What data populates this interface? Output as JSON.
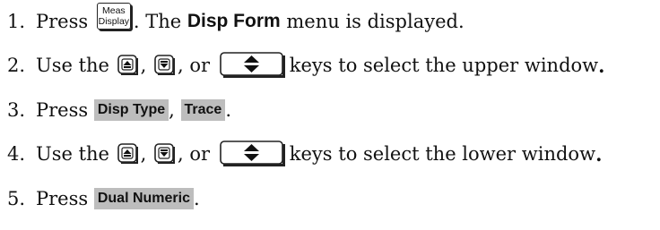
{
  "steps": [
    {
      "number": "1.",
      "text_before": "Press",
      "key_line1": "Meas",
      "key_line2": "Display",
      "text_mid": ". The",
      "menu_name": "Disp Form",
      "text_after": "menu is displayed."
    },
    {
      "number": "2.",
      "text_before": "Use the",
      "sep1": ",",
      "sep2": ", or",
      "text_after": "keys to select the upper window",
      "period": "."
    },
    {
      "number": "3.",
      "text_before": "Press",
      "softkey1": "Disp Type",
      "sep": ",",
      "softkey2": "Trace",
      "end": "."
    },
    {
      "number": "4.",
      "text_before": "Use the",
      "sep1": ",",
      "sep2": ", or",
      "text_after": "keys to select the lower window",
      "period": "."
    },
    {
      "number": "5.",
      "text_before": "Press",
      "softkey1": "Dual Numeric",
      "end": "."
    }
  ],
  "icons": {
    "up_key": "up-arrow-key-icon",
    "down_key": "down-arrow-key-icon",
    "updown_key": "up-down-arrow-key-icon"
  },
  "colors": {
    "softkey_bg": "#bdbdbd",
    "text": "#111111"
  }
}
